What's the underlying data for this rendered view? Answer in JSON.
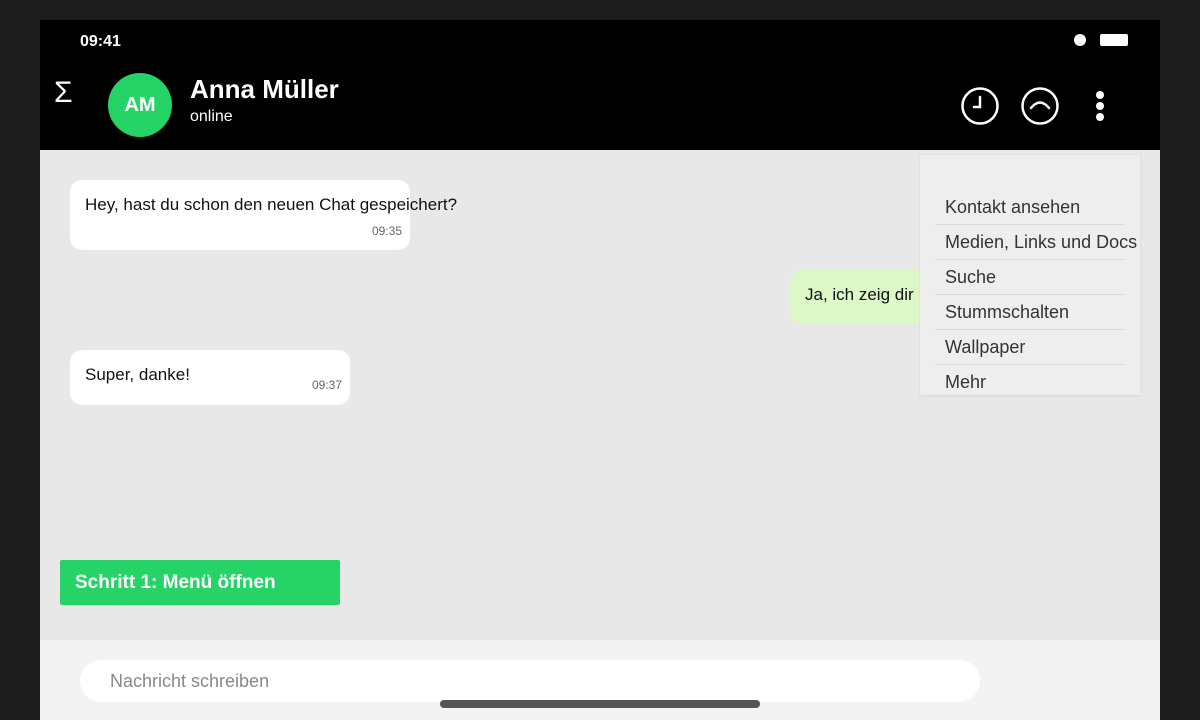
{
  "status_bar": {
    "time": "09:41"
  },
  "header": {
    "menu_icon": "Σ",
    "avatar_initials": "AM",
    "contact_name": "Anna Müller",
    "contact_status": "online",
    "icons": [
      "clock-icon",
      "chevron-up-icon",
      "more-vertical-icon"
    ]
  },
  "messages": [
    {
      "direction": "incoming",
      "text": "Hey, hast du schon den neuen Chat gespeichert?",
      "time": "09:35"
    },
    {
      "direction": "outgoing",
      "text": "Ja, ich zeig dir",
      "time": ""
    },
    {
      "direction": "incoming",
      "text": "Super, danke!",
      "time": "09:37"
    }
  ],
  "dropdown_menu": {
    "items": [
      "Kontakt ansehen",
      "Medien, Links und Docs",
      "Suche",
      "Stummschalten",
      "Wallpaper",
      "Mehr"
    ]
  },
  "step_button": {
    "label": "Schritt 1: Menü öffnen"
  },
  "composer": {
    "placeholder": "Nachricht schreiben",
    "value": ""
  },
  "colors": {
    "accent": "#25d366",
    "header_bg": "#000000",
    "chat_bg": "#e8e8e8",
    "outgoing_bubble": "#dcf8c6"
  }
}
